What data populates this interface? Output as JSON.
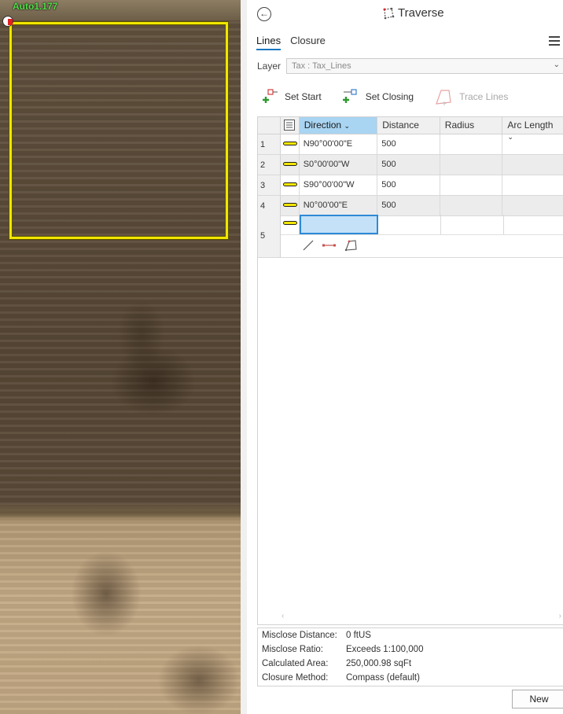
{
  "map": {
    "point_label": "Auto1.177"
  },
  "panel": {
    "title": "Traverse",
    "tabs": [
      {
        "label": "Lines",
        "active": true
      },
      {
        "label": "Closure",
        "active": false
      }
    ],
    "layer_label": "Layer",
    "layer_value": "Tax : Tax_Lines",
    "tools": {
      "set_start": "Set Start",
      "set_closing": "Set Closing",
      "trace_lines": "Trace Lines"
    },
    "grid": {
      "columns": [
        "Direction",
        "Distance",
        "Radius",
        "Arc Length"
      ],
      "rows": [
        {
          "num": "1",
          "direction": "N90°00'00\"E",
          "distance": "500",
          "radius": "",
          "arc_length": ""
        },
        {
          "num": "2",
          "direction": "S0°00'00\"W",
          "distance": "500",
          "radius": "",
          "arc_length": ""
        },
        {
          "num": "3",
          "direction": "S90°00'00\"W",
          "distance": "500",
          "radius": "",
          "arc_length": ""
        },
        {
          "num": "4",
          "direction": "N0°00'00\"E",
          "distance": "500",
          "radius": "",
          "arc_length": ""
        }
      ],
      "new_row_num": "5"
    },
    "summary": {
      "misclose_distance_label": "Misclose Distance:",
      "misclose_distance_value": "0 ftUS",
      "misclose_ratio_label": "Misclose Ratio:",
      "misclose_ratio_value": "Exceeds 1:100,000",
      "calculated_area_label": "Calculated Area:",
      "calculated_area_value": "250,000.98 sqFt",
      "closure_method_label": "Closure Method:",
      "closure_method_value": "Compass (default)"
    },
    "new_button": "New"
  },
  "colors": {
    "parcel_outline": "#f2e600",
    "point_label": "#53e04a",
    "selected_header": "#a9d4f2",
    "tab_accent": "#1a78c2"
  }
}
